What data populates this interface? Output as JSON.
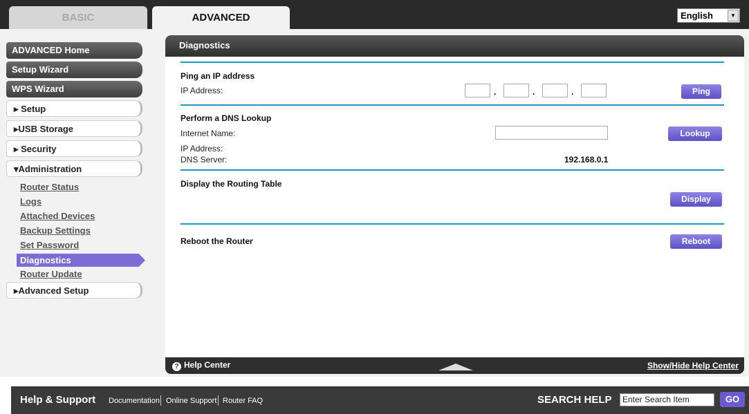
{
  "tabs": {
    "basic": "BASIC",
    "advanced": "ADVANCED"
  },
  "language": {
    "selected": "English"
  },
  "sidebar": {
    "advanced_home": "ADVANCED Home",
    "setup_wizard": "Setup Wizard",
    "wps_wizard": "WPS Wizard",
    "setup": "▸ Setup",
    "usb_storage": "▸USB Storage",
    "security": "▸ Security",
    "administration": "▾Administration",
    "admin_items": [
      "Router Status",
      "Logs",
      "Attached Devices",
      "Backup Settings",
      "Set Password",
      "Diagnostics",
      "Router Update"
    ],
    "advanced_setup": "▸Advanced Setup"
  },
  "panel": {
    "title": "Diagnostics",
    "ping": {
      "heading": "Ping an IP address",
      "ip_label": "IP Address:",
      "button": "Ping",
      "dot": "."
    },
    "dns": {
      "heading": "Perform a DNS Lookup",
      "name_label": "Internet Name:",
      "ip_label": "IP Address:",
      "dns_label": "DNS Server:",
      "dns_value": "192.168.0.1",
      "button": "Lookup"
    },
    "routing": {
      "heading": "Display the Routing Table",
      "button": "Display"
    },
    "reboot": {
      "heading": "Reboot the Router",
      "button": "Reboot"
    },
    "footer": {
      "help_center": "Help Center",
      "toggle": "Show/Hide Help Center",
      "help_icon": "?"
    }
  },
  "bottom": {
    "title": "Help & Support",
    "links": [
      "Documentation",
      "Online Support",
      "Router FAQ"
    ],
    "search_title": "SEARCH HELP",
    "search_value": "Enter Search Item",
    "go": "GO"
  }
}
